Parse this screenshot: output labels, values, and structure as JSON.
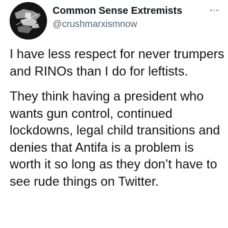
{
  "author": {
    "display_name": "Common Sense Extremists",
    "handle": "@crushmarxismnow",
    "avatar_icon": "profile-avatar-icon"
  },
  "actions": {
    "more_icon": "more-options-icon"
  },
  "tweet": {
    "paragraph_1": "I have less respect for never trumpers and RINOs than I do for leftists.",
    "paragraph_2": "They think having a president who wants gun control, continued lockdowns, legal child transitions and denies that Antifa is a problem is worth it so long as they don’t have to see rude things on Twitter."
  },
  "colors": {
    "background": "#ffffff",
    "name_text": "#0f1419",
    "handle_text": "#536471",
    "body_text": "#111111",
    "avatar_bg": "#141414"
  }
}
